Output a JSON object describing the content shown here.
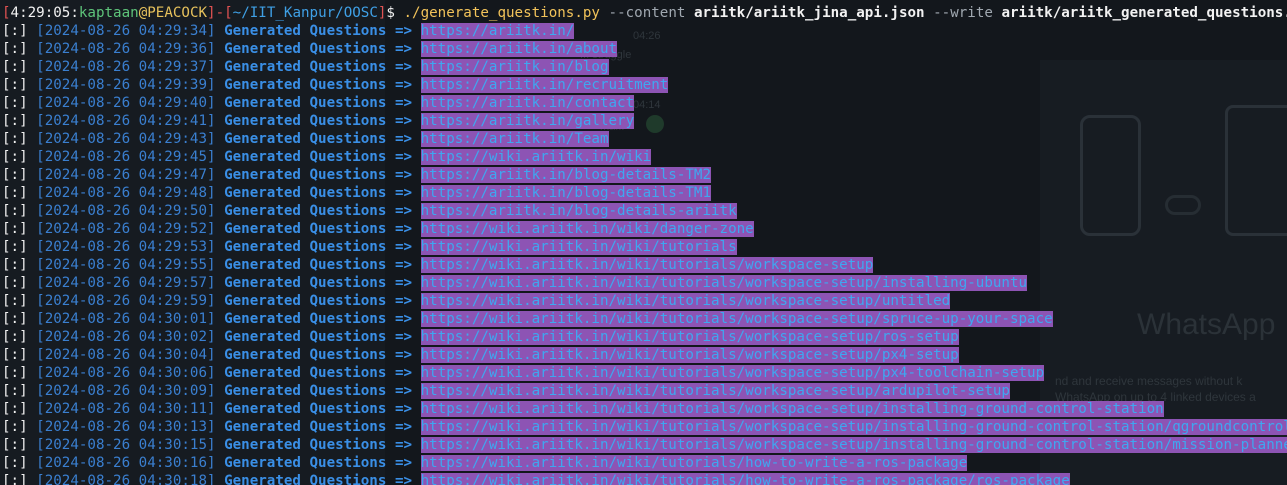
{
  "background": {
    "whatsapp_title": "WhatsApp",
    "whatsapp_sub1": "nd and receive messages without k",
    "whatsapp_sub2": "WhatsApp on up to 4 linked devices a",
    "time1": "04:26",
    "msg1": "... struggle",
    "time2": "04:14",
    "msg2": "ma..."
  },
  "prompt": {
    "time": "4:29:05",
    "user": "kaptaan",
    "at": "@",
    "host": "PEACOCK",
    "path": "~/IIT_Kanpur/OOSC",
    "dollar": "$",
    "command": "./generate_questions.py",
    "flag_content": "--content",
    "content_value": "ariitk/ariitk_jina_api.json",
    "flag_write": "--write",
    "write_value": "ariitk/ariitk_generated_questions.json"
  },
  "colors": {
    "selection": "#8d54b4",
    "url": "#3fa7f0",
    "label": "#3a8fe6",
    "date": "#3a7fd0"
  },
  "log": {
    "prefix": "[:]",
    "label": "Generated Questions",
    "arrow": "=>",
    "entries": [
      {
        "timestamp": "[2024-08-26 04:29:34]",
        "url": "https://ariitk.in/"
      },
      {
        "timestamp": "[2024-08-26 04:29:36]",
        "url": "https://ariitk.in/about"
      },
      {
        "timestamp": "[2024-08-26 04:29:37]",
        "url": "https://ariitk.in/blog"
      },
      {
        "timestamp": "[2024-08-26 04:29:39]",
        "url": "https://ariitk.in/recruitment"
      },
      {
        "timestamp": "[2024-08-26 04:29:40]",
        "url": "https://ariitk.in/contact"
      },
      {
        "timestamp": "[2024-08-26 04:29:41]",
        "url": "https://ariitk.in/gallery"
      },
      {
        "timestamp": "[2024-08-26 04:29:43]",
        "url": "https://ariitk.in/Team"
      },
      {
        "timestamp": "[2024-08-26 04:29:45]",
        "url": "https://wiki.ariitk.in/wiki"
      },
      {
        "timestamp": "[2024-08-26 04:29:47]",
        "url": "https://ariitk.in/blog-details-TM2"
      },
      {
        "timestamp": "[2024-08-26 04:29:48]",
        "url": "https://ariitk.in/blog-details-TM1"
      },
      {
        "timestamp": "[2024-08-26 04:29:50]",
        "url": "https://ariitk.in/blog-details-ariitk"
      },
      {
        "timestamp": "[2024-08-26 04:29:52]",
        "url": "https://wiki.ariitk.in/wiki/danger-zone"
      },
      {
        "timestamp": "[2024-08-26 04:29:53]",
        "url": "https://wiki.ariitk.in/wiki/tutorials"
      },
      {
        "timestamp": "[2024-08-26 04:29:55]",
        "url": "https://wiki.ariitk.in/wiki/tutorials/workspace-setup"
      },
      {
        "timestamp": "[2024-08-26 04:29:57]",
        "url": "https://wiki.ariitk.in/wiki/tutorials/workspace-setup/installing-ubuntu"
      },
      {
        "timestamp": "[2024-08-26 04:29:59]",
        "url": "https://wiki.ariitk.in/wiki/tutorials/workspace-setup/untitled"
      },
      {
        "timestamp": "[2024-08-26 04:30:01]",
        "url": "https://wiki.ariitk.in/wiki/tutorials/workspace-setup/spruce-up-your-space"
      },
      {
        "timestamp": "[2024-08-26 04:30:02]",
        "url": "https://wiki.ariitk.in/wiki/tutorials/workspace-setup/ros-setup"
      },
      {
        "timestamp": "[2024-08-26 04:30:04]",
        "url": "https://wiki.ariitk.in/wiki/tutorials/workspace-setup/px4-setup"
      },
      {
        "timestamp": "[2024-08-26 04:30:06]",
        "url": "https://wiki.ariitk.in/wiki/tutorials/workspace-setup/px4-toolchain-setup"
      },
      {
        "timestamp": "[2024-08-26 04:30:09]",
        "url": "https://wiki.ariitk.in/wiki/tutorials/workspace-setup/ardupilot-setup"
      },
      {
        "timestamp": "[2024-08-26 04:30:11]",
        "url": "https://wiki.ariitk.in/wiki/tutorials/workspace-setup/installing-ground-control-station"
      },
      {
        "timestamp": "[2024-08-26 04:30:13]",
        "url": "https://wiki.ariitk.in/wiki/tutorials/workspace-setup/installing-ground-control-station/qgroundcontrol"
      },
      {
        "timestamp": "[2024-08-26 04:30:15]",
        "url": "https://wiki.ariitk.in/wiki/tutorials/workspace-setup/installing-ground-control-station/mission-planner"
      },
      {
        "timestamp": "[2024-08-26 04:30:16]",
        "url": "https://wiki.ariitk.in/wiki/tutorials/how-to-write-a-ros-package"
      },
      {
        "timestamp": "[2024-08-26 04:30:18]",
        "url": "https://wiki.ariitk.in/wiki/tutorials/how-to-write-a-ros-package/ros-package"
      }
    ]
  }
}
